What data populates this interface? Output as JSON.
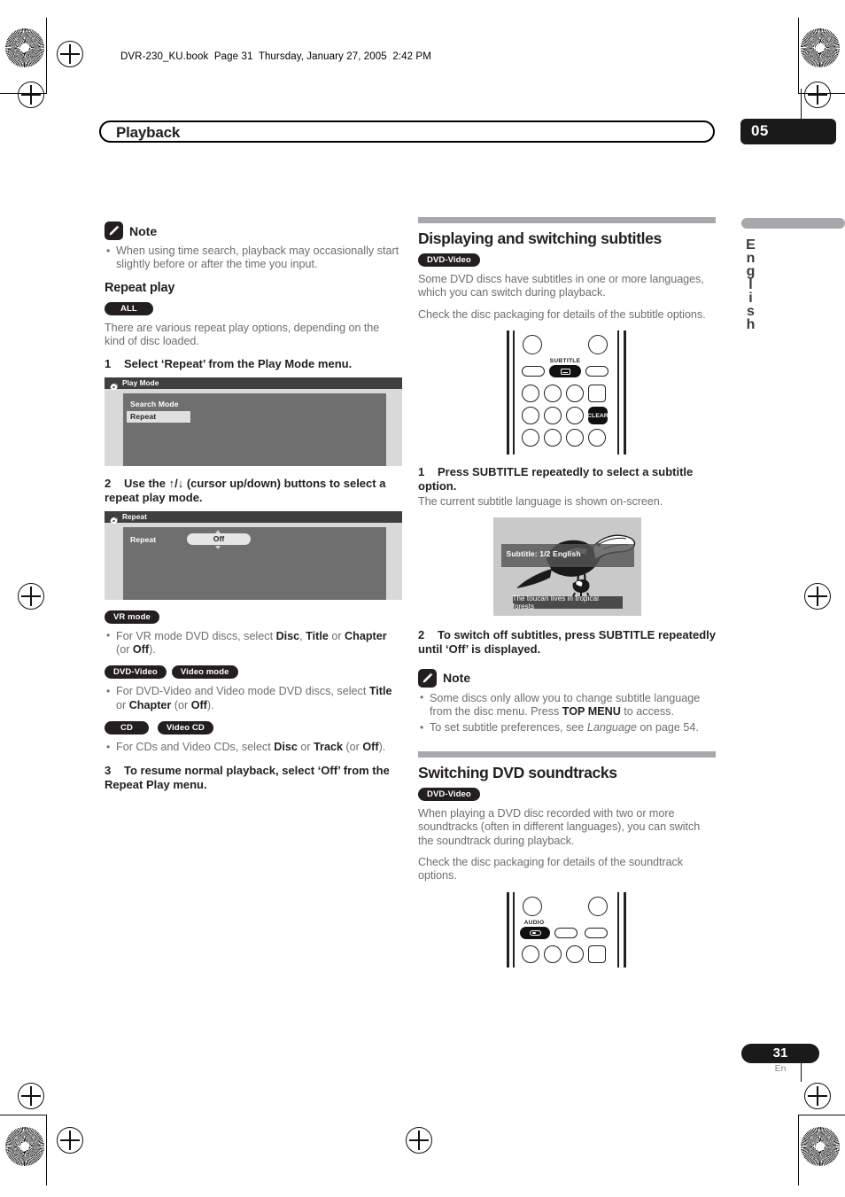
{
  "header": {
    "file_line": "DVR-230_KU.book  Page 31  Thursday, January 27, 2005  2:42 PM"
  },
  "title_bar": {
    "chapter_title": "Playback",
    "chapter_number": "05"
  },
  "side_tab": {
    "language": "English"
  },
  "footer": {
    "page_number": "31",
    "language_code": "En"
  },
  "left_column": {
    "note": {
      "icon": "pencil-note-icon",
      "title": "Note",
      "bullets": [
        "When using time search, playback may occasionally start slightly before or after the time you input."
      ]
    },
    "repeat_play": {
      "heading": "Repeat play",
      "badges": [
        "ALL"
      ],
      "intro": "There are various repeat play options, depending on the kind of disc loaded.",
      "step1": {
        "number": "1",
        "text": "Select ‘Repeat’ from the Play Mode menu."
      },
      "play_mode_osd": {
        "title": "Play Mode",
        "icon": "disc-arrow-icon",
        "item_label": "Search Mode",
        "selected_item": "Repeat"
      },
      "step2": {
        "number": "2",
        "text_before": "Use the ",
        "cursor_up": "↑",
        "cursor_sep": "/",
        "cursor_down": "↓",
        "text_after": " (cursor up/down) buttons to select a repeat play mode."
      },
      "repeat_osd": {
        "title": "Repeat",
        "icon": "disc-arrow-icon",
        "item_label": "Repeat",
        "selected_value": "Off"
      },
      "disc_groups": [
        {
          "badges": [
            "VR mode"
          ],
          "bullet_html": "For VR mode DVD discs, select <b>Disc</b>, <b>Title</b> or <b>Chapter</b> (or <b>Off</b>)."
        },
        {
          "badges": [
            "DVD-Video",
            "Video mode"
          ],
          "bullet_html": "For DVD-Video and Video mode DVD discs, select <b>Title</b> or <b>Chapter</b> (or <b>Off</b>)."
        },
        {
          "badges": [
            "CD",
            "Video CD"
          ],
          "bullet_html": "For CDs and Video CDs, select <b>Disc</b> or <b>Track</b> (or <b>Off</b>)."
        }
      ],
      "step3": {
        "number": "3",
        "text": "To resume normal playback, select ‘Off’ from the Repeat Play menu."
      }
    }
  },
  "right_column": {
    "subtitles_section": {
      "heading": "Displaying and switching subtitles",
      "badges": [
        "DVD-Video"
      ],
      "paragraphs": [
        "Some DVD discs have subtitles in one or more languages, which you can switch during playback.",
        "Check the disc packaging for details of the subtitle options."
      ],
      "remote": {
        "highlight_button_label": "SUBTITLE",
        "highlight_icon": "subtitle-icon",
        "clear_button_label": "CLEAR"
      },
      "step1": {
        "number": "1",
        "text": "Press SUBTITLE repeatedly to select a subtitle option.",
        "note": "The current subtitle language is shown on-screen."
      },
      "tv_screen": {
        "osd_text": "Subtitle: 1/2 English",
        "subtitle_text": "The toucan lives in tropical forests",
        "image": "toucan-illustration"
      },
      "step2": {
        "number": "2",
        "text": "To switch off subtitles, press SUBTITLE repeatedly until ‘Off’ is displayed."
      },
      "note": {
        "icon": "pencil-note-icon",
        "title": "Note",
        "bullets_html": [
          "Some discs only allow you to change subtitle language from the disc menu. Press <b>TOP MENU</b> to access.",
          "To set subtitle preferences, see <i>Language</i> on page 54."
        ]
      }
    },
    "soundtracks_section": {
      "heading": "Switching DVD soundtracks",
      "badges": [
        "DVD-Video"
      ],
      "paragraphs": [
        "When playing a DVD disc recorded with two or more soundtracks (often in different languages), you can switch the soundtrack during playback.",
        "Check the disc packaging for details of the soundtrack options."
      ],
      "remote": {
        "highlight_button_label": "AUDIO",
        "highlight_icon": "audio-icon"
      }
    }
  }
}
